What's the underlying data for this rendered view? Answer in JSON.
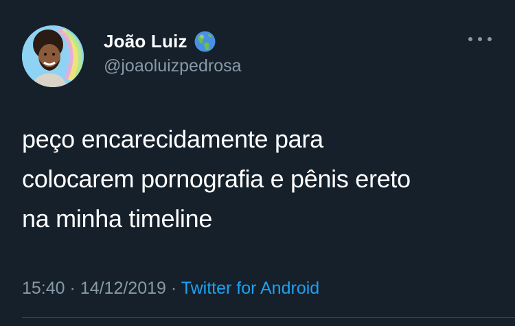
{
  "author": {
    "display_name": "João Luiz",
    "handle": "@joaoluizpedrosa",
    "badge_icon": "globe-americas-icon"
  },
  "tweet": {
    "text_lines": [
      "peço encarecidamente para",
      "colocarem pornografia e pênis ereto",
      "na minha timeline"
    ],
    "time": "15:40",
    "date": "14/12/2019",
    "separator": "·",
    "source": "Twitter for Android"
  },
  "colors": {
    "background": "#15202b",
    "text_primary": "#ffffff",
    "text_secondary": "#8899a6",
    "link": "#1da1f2",
    "divider": "#38444d"
  },
  "icons": {
    "more": "more-options-icon"
  }
}
